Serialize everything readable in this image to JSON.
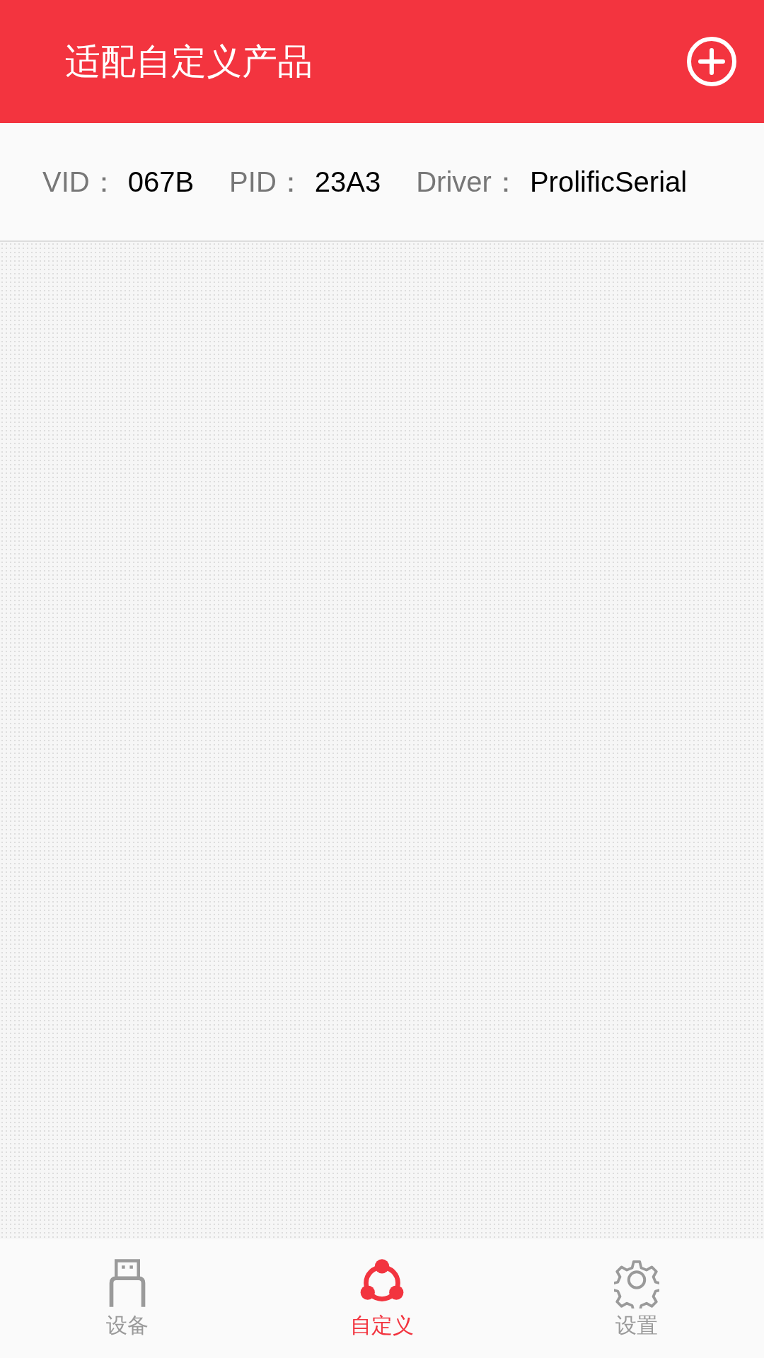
{
  "header": {
    "title": "适配自定义产品"
  },
  "device_info": [
    {
      "label": "VID：",
      "value": "067B"
    },
    {
      "label": "PID：",
      "value": "23A3"
    },
    {
      "label": "Driver：",
      "value": "ProlificSerial"
    }
  ],
  "bottom_tabs": [
    {
      "kind": "usb",
      "label": "设备",
      "selected": false
    },
    {
      "kind": "share",
      "label": "自定义",
      "selected": true
    },
    {
      "kind": "gear",
      "label": "设置",
      "selected": false
    }
  ]
}
